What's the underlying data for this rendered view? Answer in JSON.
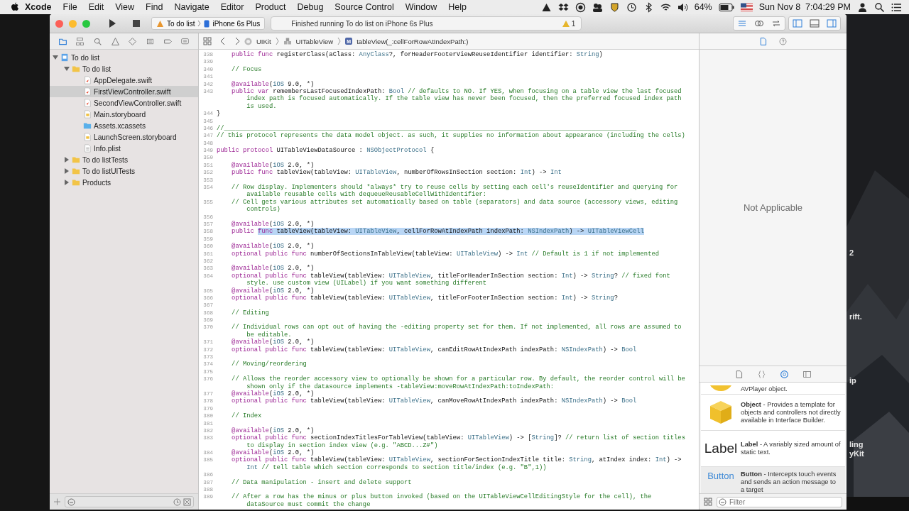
{
  "menu_bar": {
    "app": "Xcode",
    "items": [
      "File",
      "Edit",
      "View",
      "Find",
      "Navigate",
      "Editor",
      "Product",
      "Debug",
      "Source Control",
      "Window",
      "Help"
    ],
    "battery_text": "64%",
    "clock": "Sun Nov 8  7:04:29 PM"
  },
  "desktop": {
    "fragments": [
      "2",
      "rift.",
      "ip",
      "ling",
      "yKit"
    ]
  },
  "toolbar": {
    "scheme": {
      "target": "To do list",
      "device": "iPhone 6s Plus"
    },
    "status": "Finished running To do list on iPhone 6s Plus",
    "warnings": "1",
    "editor_modes": [
      {
        "selected": true
      },
      {
        "selected": false
      },
      {
        "selected": false
      }
    ],
    "panels": [
      {
        "selected": true
      },
      {
        "selected": false
      },
      {
        "selected": true
      }
    ]
  },
  "navigator": {
    "tabs": [
      {
        "selected": true
      },
      {
        "selected": false
      },
      {
        "selected": false
      },
      {
        "selected": false
      },
      {
        "selected": false
      },
      {
        "selected": false
      },
      {
        "selected": false
      },
      {
        "selected": false
      }
    ],
    "tree": [
      {
        "name": "To do list",
        "kind": "project",
        "expanded": true,
        "selected": false,
        "children": [
          {
            "name": "To do list",
            "kind": "folder",
            "expanded": true,
            "selected": false,
            "children": [
              {
                "name": "AppDelegate.swift",
                "kind": "swift",
                "selected": false
              },
              {
                "name": "FirstViewController.swift",
                "kind": "swift",
                "selected": true
              },
              {
                "name": "SecondViewController.swift",
                "kind": "swift",
                "selected": false
              },
              {
                "name": "Main.storyboard",
                "kind": "storyboard",
                "selected": false
              },
              {
                "name": "Assets.xcassets",
                "kind": "assets",
                "selected": false
              },
              {
                "name": "LaunchScreen.storyboard",
                "kind": "storyboard",
                "selected": false
              },
              {
                "name": "Info.plist",
                "kind": "plist",
                "selected": false
              }
            ]
          },
          {
            "name": "To do listTests",
            "kind": "folder",
            "expanded": false,
            "selected": false
          },
          {
            "name": "To do listUITests",
            "kind": "folder",
            "expanded": false,
            "selected": false
          },
          {
            "name": "Products",
            "kind": "folder",
            "expanded": false,
            "selected": false
          }
        ]
      }
    ]
  },
  "jump_bar": [
    {
      "kind": "framework",
      "label": "UIKit"
    },
    {
      "kind": "class",
      "label": "UITableView"
    },
    {
      "kind": "method",
      "badge": "M",
      "label": "tableView(_:cellForRowAtIndexPath:)"
    }
  ],
  "code": [
    {
      "number": "338",
      "kind": "member",
      "spans": [
        {
          "kind": "kw",
          "text": "public func"
        },
        {
          "kind": "p",
          "text": " registerClass(aClass: "
        },
        {
          "kind": "ty",
          "text": "AnyClass"
        },
        {
          "kind": "p",
          "text": "?, forHeaderFooterViewReuseIdentifier identifier: "
        },
        {
          "kind": "ty",
          "text": "String"
        },
        {
          "kind": "p",
          "text": ")"
        }
      ]
    },
    {
      "number": "339"
    },
    {
      "number": "340",
      "kind": "member",
      "spans": [
        {
          "kind": "cm",
          "text": "// Focus"
        }
      ]
    },
    {
      "number": "341"
    },
    {
      "number": "342",
      "kind": "member",
      "spans": [
        {
          "kind": "kw",
          "text": "@available"
        },
        {
          "kind": "p",
          "text": "("
        },
        {
          "kind": "ty",
          "text": "iOS"
        },
        {
          "kind": "p",
          "text": " 9.0, *)"
        }
      ]
    },
    {
      "number": "343",
      "kind": "member",
      "spans": [
        {
          "kind": "kw",
          "text": "public var"
        },
        {
          "kind": "p",
          "text": " remembersLastFocusedIndexPath: "
        },
        {
          "kind": "ty",
          "text": "Bool"
        },
        {
          "kind": "cm",
          "text": " // defaults to NO. If YES, when focusing on a table view the last focused"
        }
      ],
      "wraps": [
        [
          {
            "kind": "cm",
            "text": "index path is focused automatically. If the table view has never been focused, then the preferred focused index path"
          }
        ],
        [
          {
            "kind": "cm",
            "text": "is used."
          }
        ]
      ]
    },
    {
      "number": "344",
      "kind": "top",
      "spans": [
        {
          "kind": "p",
          "text": "}"
        }
      ]
    },
    {
      "number": "345"
    },
    {
      "number": "346",
      "kind": "top",
      "spans": [
        {
          "kind": "cm",
          "text": "//______________________________________________________________________________________________________________"
        }
      ]
    },
    {
      "number": "347",
      "kind": "top",
      "spans": [
        {
          "kind": "cm",
          "text": "// this protocol represents the data model object. as such, it supplies no information about appearance (including the cells)"
        }
      ]
    },
    {
      "number": "348"
    },
    {
      "number": "349",
      "kind": "top",
      "spans": [
        {
          "kind": "kw",
          "text": "public protocol"
        },
        {
          "kind": "p",
          "text": " UITableViewDataSource : "
        },
        {
          "kind": "ty",
          "text": "NSObjectProtocol"
        },
        {
          "kind": "p",
          "text": " {"
        }
      ]
    },
    {
      "number": "350"
    },
    {
      "number": "351",
      "kind": "member",
      "spans": [
        {
          "kind": "kw",
          "text": "@available"
        },
        {
          "kind": "p",
          "text": "("
        },
        {
          "kind": "ty",
          "text": "iOS"
        },
        {
          "kind": "p",
          "text": " 2.0, *)"
        }
      ]
    },
    {
      "number": "352",
      "kind": "member",
      "spans": [
        {
          "kind": "kw",
          "text": "public func"
        },
        {
          "kind": "p",
          "text": " tableView(tableView: "
        },
        {
          "kind": "ty",
          "text": "UITableView"
        },
        {
          "kind": "p",
          "text": ", numberOfRowsInSection section: "
        },
        {
          "kind": "ty",
          "text": "Int"
        },
        {
          "kind": "p",
          "text": ") -> "
        },
        {
          "kind": "ty",
          "text": "Int"
        }
      ]
    },
    {
      "number": "353"
    },
    {
      "number": "354",
      "kind": "member",
      "spans": [
        {
          "kind": "cm",
          "text": "// Row display. Implementers should *always* try to reuse cells by setting each cell's reuseIdentifier and querying for"
        }
      ],
      "wraps": [
        [
          {
            "kind": "cm",
            "text": "available reusable cells with dequeueReusableCellWithIdentifier:"
          }
        ]
      ]
    },
    {
      "number": "355",
      "kind": "member",
      "spans": [
        {
          "kind": "cm",
          "text": "// Cell gets various attributes set automatically based on table (separators) and data source (accessory views, editing"
        }
      ],
      "wraps": [
        [
          {
            "kind": "cm",
            "text": "controls)"
          }
        ]
      ]
    },
    {
      "number": "356"
    },
    {
      "number": "357",
      "kind": "member",
      "spans": [
        {
          "kind": "kw",
          "text": "@available"
        },
        {
          "kind": "p",
          "text": "("
        },
        {
          "kind": "ty",
          "text": "iOS"
        },
        {
          "kind": "p",
          "text": " 2.0, *)"
        }
      ]
    },
    {
      "number": "358",
      "kind": "member",
      "spans": [
        {
          "kind": "kw",
          "text": "public "
        }
      ],
      "selection": [
        {
          "kind": "kw",
          "text": "func"
        },
        {
          "kind": "p",
          "text": " tableView(tableView: "
        },
        {
          "kind": "ty",
          "text": "UITableView"
        },
        {
          "kind": "p",
          "text": ", cellForRowAtIndexPath indexPath: "
        },
        {
          "kind": "ty",
          "text": "NSIndexPath"
        },
        {
          "kind": "p",
          "text": ") -> "
        },
        {
          "kind": "ty",
          "text": "UITableViewCell"
        }
      ]
    },
    {
      "number": "359"
    },
    {
      "number": "360",
      "kind": "member",
      "spans": [
        {
          "kind": "kw",
          "text": "@available"
        },
        {
          "kind": "p",
          "text": "("
        },
        {
          "kind": "ty",
          "text": "iOS"
        },
        {
          "kind": "p",
          "text": " 2.0, *)"
        }
      ]
    },
    {
      "number": "361",
      "kind": "member",
      "spans": [
        {
          "kind": "kw",
          "text": "optional public func"
        },
        {
          "kind": "p",
          "text": " numberOfSectionsInTableView(tableView: "
        },
        {
          "kind": "ty",
          "text": "UITableView"
        },
        {
          "kind": "p",
          "text": ") -> "
        },
        {
          "kind": "ty",
          "text": "Int"
        },
        {
          "kind": "cm",
          "text": " // Default is 1 if not implemented"
        }
      ]
    },
    {
      "number": "362"
    },
    {
      "number": "363",
      "kind": "member",
      "spans": [
        {
          "kind": "kw",
          "text": "@available"
        },
        {
          "kind": "p",
          "text": "("
        },
        {
          "kind": "ty",
          "text": "iOS"
        },
        {
          "kind": "p",
          "text": " 2.0, *)"
        }
      ]
    },
    {
      "number": "364",
      "kind": "member",
      "spans": [
        {
          "kind": "kw",
          "text": "optional public func"
        },
        {
          "kind": "p",
          "text": " tableView(tableView: "
        },
        {
          "kind": "ty",
          "text": "UITableView"
        },
        {
          "kind": "p",
          "text": ", titleForHeaderInSection section: "
        },
        {
          "kind": "ty",
          "text": "Int"
        },
        {
          "kind": "p",
          "text": ") -> "
        },
        {
          "kind": "ty",
          "text": "String"
        },
        {
          "kind": "p",
          "text": "?"
        },
        {
          "kind": "cm",
          "text": " // fixed font"
        }
      ],
      "wraps": [
        [
          {
            "kind": "cm",
            "text": "style. use custom view (UILabel) if you want something different"
          }
        ]
      ]
    },
    {
      "number": "365",
      "kind": "member",
      "spans": [
        {
          "kind": "kw",
          "text": "@available"
        },
        {
          "kind": "p",
          "text": "("
        },
        {
          "kind": "ty",
          "text": "iOS"
        },
        {
          "kind": "p",
          "text": " 2.0, *)"
        }
      ]
    },
    {
      "number": "366",
      "kind": "member",
      "spans": [
        {
          "kind": "kw",
          "text": "optional public func"
        },
        {
          "kind": "p",
          "text": " tableView(tableView: "
        },
        {
          "kind": "ty",
          "text": "UITableView"
        },
        {
          "kind": "p",
          "text": ", titleForFooterInSection section: "
        },
        {
          "kind": "ty",
          "text": "Int"
        },
        {
          "kind": "p",
          "text": ") -> "
        },
        {
          "kind": "ty",
          "text": "String"
        },
        {
          "kind": "p",
          "text": "?"
        }
      ]
    },
    {
      "number": "367"
    },
    {
      "number": "368",
      "kind": "member",
      "spans": [
        {
          "kind": "cm",
          "text": "// Editing"
        }
      ]
    },
    {
      "number": "369"
    },
    {
      "number": "370",
      "kind": "member",
      "spans": [
        {
          "kind": "cm",
          "text": "// Individual rows can opt out of having the -editing property set for them. If not implemented, all rows are assumed to"
        }
      ],
      "wraps": [
        [
          {
            "kind": "cm",
            "text": "be editable."
          }
        ]
      ]
    },
    {
      "number": "371",
      "kind": "member",
      "spans": [
        {
          "kind": "kw",
          "text": "@available"
        },
        {
          "kind": "p",
          "text": "("
        },
        {
          "kind": "ty",
          "text": "iOS"
        },
        {
          "kind": "p",
          "text": " 2.0, *)"
        }
      ]
    },
    {
      "number": "372",
      "kind": "member",
      "spans": [
        {
          "kind": "kw",
          "text": "optional public func"
        },
        {
          "kind": "p",
          "text": " tableView(tableView: "
        },
        {
          "kind": "ty",
          "text": "UITableView"
        },
        {
          "kind": "p",
          "text": ", canEditRowAtIndexPath indexPath: "
        },
        {
          "kind": "ty",
          "text": "NSIndexPath"
        },
        {
          "kind": "p",
          "text": ") -> "
        },
        {
          "kind": "ty",
          "text": "Bool"
        }
      ]
    },
    {
      "number": "373"
    },
    {
      "number": "374",
      "kind": "member",
      "spans": [
        {
          "kind": "cm",
          "text": "// Moving/reordering"
        }
      ]
    },
    {
      "number": "375"
    },
    {
      "number": "376",
      "kind": "member",
      "spans": [
        {
          "kind": "cm",
          "text": "// Allows the reorder accessory view to optionally be shown for a particular row. By default, the reorder control will be"
        }
      ],
      "wraps": [
        [
          {
            "kind": "cm",
            "text": "shown only if the datasource implements -tableView:moveRowAtIndexPath:toIndexPath:"
          }
        ]
      ]
    },
    {
      "number": "377",
      "kind": "member",
      "spans": [
        {
          "kind": "kw",
          "text": "@available"
        },
        {
          "kind": "p",
          "text": "("
        },
        {
          "kind": "ty",
          "text": "iOS"
        },
        {
          "kind": "p",
          "text": " 2.0, *)"
        }
      ]
    },
    {
      "number": "378",
      "kind": "member",
      "spans": [
        {
          "kind": "kw",
          "text": "optional public func"
        },
        {
          "kind": "p",
          "text": " tableView(tableView: "
        },
        {
          "kind": "ty",
          "text": "UITableView"
        },
        {
          "kind": "p",
          "text": ", canMoveRowAtIndexPath indexPath: "
        },
        {
          "kind": "ty",
          "text": "NSIndexPath"
        },
        {
          "kind": "p",
          "text": ") -> "
        },
        {
          "kind": "ty",
          "text": "Bool"
        }
      ]
    },
    {
      "number": "379"
    },
    {
      "number": "380",
      "kind": "member",
      "spans": [
        {
          "kind": "cm",
          "text": "// Index"
        }
      ]
    },
    {
      "number": "381"
    },
    {
      "number": "382",
      "kind": "member",
      "spans": [
        {
          "kind": "kw",
          "text": "@available"
        },
        {
          "kind": "p",
          "text": "("
        },
        {
          "kind": "ty",
          "text": "iOS"
        },
        {
          "kind": "p",
          "text": " 2.0, *)"
        }
      ]
    },
    {
      "number": "383",
      "kind": "member",
      "spans": [
        {
          "kind": "kw",
          "text": "optional public func"
        },
        {
          "kind": "p",
          "text": " sectionIndexTitlesForTableView(tableView: "
        },
        {
          "kind": "ty",
          "text": "UITableView"
        },
        {
          "kind": "p",
          "text": ") -> ["
        },
        {
          "kind": "ty",
          "text": "String"
        },
        {
          "kind": "p",
          "text": "]?"
        },
        {
          "kind": "cm",
          "text": " // return list of section titles"
        }
      ],
      "wraps": [
        [
          {
            "kind": "cm",
            "text": "to display in section index view (e.g. \"ABCD...Z#\")"
          }
        ]
      ]
    },
    {
      "number": "384",
      "kind": "member",
      "spans": [
        {
          "kind": "kw",
          "text": "@available"
        },
        {
          "kind": "p",
          "text": "("
        },
        {
          "kind": "ty",
          "text": "iOS"
        },
        {
          "kind": "p",
          "text": " 2.0, *)"
        }
      ]
    },
    {
      "number": "385",
      "kind": "member",
      "spans": [
        {
          "kind": "kw",
          "text": "optional public func"
        },
        {
          "kind": "p",
          "text": " tableView(tableView: "
        },
        {
          "kind": "ty",
          "text": "UITableView"
        },
        {
          "kind": "p",
          "text": ", sectionForSectionIndexTitle title: "
        },
        {
          "kind": "ty",
          "text": "String"
        },
        {
          "kind": "p",
          "text": ", atIndex index: "
        },
        {
          "kind": "ty",
          "text": "Int"
        },
        {
          "kind": "p",
          "text": ") ->"
        }
      ],
      "wraps": [
        [
          {
            "kind": "ty",
            "text": "Int"
          },
          {
            "kind": "cm",
            "text": " // tell table which section corresponds to section title/index (e.g. \"B\",1))"
          }
        ]
      ]
    },
    {
      "number": "386"
    },
    {
      "number": "387",
      "kind": "member",
      "spans": [
        {
          "kind": "cm",
          "text": "// Data manipulation - insert and delete support"
        }
      ]
    },
    {
      "number": "388"
    },
    {
      "number": "389",
      "kind": "member",
      "spans": [
        {
          "kind": "cm",
          "text": "// After a row has the minus or plus button invoked (based on the UITableViewCellEditingStyle for the cell), the"
        }
      ],
      "wraps": [
        [
          {
            "kind": "cm",
            "text": "dataSource must commit the change"
          }
        ]
      ]
    }
  ],
  "inspector": {
    "tabs": [
      {
        "selected": true
      },
      {
        "selected": false
      }
    ],
    "message": "Not Applicable"
  },
  "library": {
    "tabs": [
      {
        "selected": false
      },
      {
        "selected": false
      },
      {
        "selected": true
      },
      {
        "selected": false
      }
    ],
    "items": [
      {
        "kind": "sphere",
        "text": "AVPlayer object.",
        "selected": false
      },
      {
        "kind": "cube",
        "text": "**Object** - Provides a template for objects and controllers not directly available in Interface Builder.",
        "selected": false
      },
      {
        "kind": "label",
        "preview": "Label",
        "text": "**Label** - A variably sized amount of static text.",
        "selected": false
      },
      {
        "kind": "button",
        "preview": "Button",
        "text": "**Button** - Intercepts touch events and sends an action message to a target",
        "selected": true
      }
    ],
    "filter": {
      "placeholder": "Filter"
    }
  }
}
